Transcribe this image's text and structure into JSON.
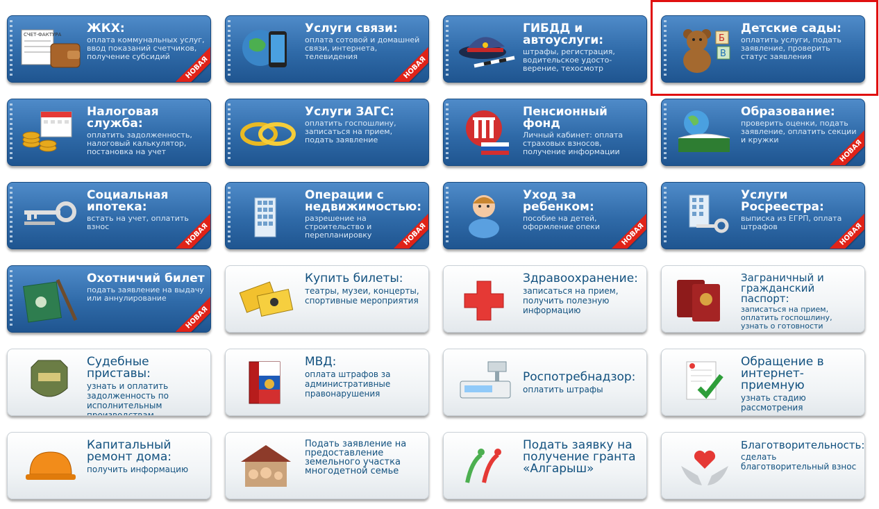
{
  "badge_new": "НОВАЯ",
  "accent": {
    "tile_blue": "#2f6aa8",
    "highlight": "#e01010",
    "ribbon": "#e02318"
  },
  "tiles": [
    {
      "id": "zhkh",
      "title": "ЖКХ:",
      "desc": "оплата коммунальных услуг, ввод показаний счетчиков, получение субсидий",
      "style": "blue",
      "new": true,
      "icon": "invoice-wallet-icon"
    },
    {
      "id": "svyaz",
      "title": "Услуги связи:",
      "desc": "оплата сотовой и домашней связи, интернета, телевидения",
      "style": "blue",
      "new": true,
      "icon": "globe-phone-icon"
    },
    {
      "id": "gibdd",
      "title": "ГИБДД и автоуслуги:",
      "desc": "штрафы, регистрация, водительское удосто-верение, техосмотр",
      "style": "blue",
      "new": false,
      "icon": "police-cap-icon"
    },
    {
      "id": "sady",
      "title": "Детские сады:",
      "desc": "оплатить услуги, подать заявление, проверить статус заявления",
      "style": "blue",
      "new": false,
      "icon": "teddy-bear-icon"
    },
    {
      "id": "nalog",
      "title": "Налоговая служба:",
      "desc": "оплатить задолженность, налоговый калькулятор, постановка на учет",
      "style": "blue",
      "new": false,
      "icon": "coins-calendar-icon"
    },
    {
      "id": "zags",
      "title": "Услуги ЗАГС:",
      "desc": "оплатить госпошлину, записаться на прием, подать заявление",
      "style": "blue",
      "new": false,
      "icon": "rings-icon"
    },
    {
      "id": "pfr",
      "title": "Пенсионный фонд",
      "desc": "Личный кабинет: оплата страховых взносов, получение информации",
      "style": "blue",
      "new": false,
      "icon": "pfr-logo-icon"
    },
    {
      "id": "obraz",
      "title": "Образование:",
      "desc": "проверить оценки, подать заявление, оплатить секции и кружки",
      "style": "blue",
      "new": true,
      "icon": "globe-book-icon"
    },
    {
      "id": "ipoteka",
      "title": "Социальная ипотека:",
      "desc": "встать на учет, оплатить взнос",
      "style": "blue",
      "new": true,
      "icon": "keys-icon"
    },
    {
      "id": "nedv",
      "title": "Операции с недвижимостью:",
      "desc": "разрешение на строительство и перепланировку",
      "style": "blue",
      "new": true,
      "icon": "building-icon"
    },
    {
      "id": "rebenok",
      "title": "Уход за ребенком:",
      "desc": "пособие на детей, оформление опеки",
      "style": "blue",
      "new": true,
      "icon": "child-icon"
    },
    {
      "id": "rosreestr",
      "title": "Услуги Росреестра:",
      "desc": "выписка из ЕГРП, оплата штрафов",
      "style": "blue",
      "new": true,
      "icon": "building-keys-icon"
    },
    {
      "id": "ohota",
      "title": "Охотничий билет",
      "desc": "подать заявление на выдачу или аннулирование",
      "style": "blue",
      "new": true,
      "icon": "hunting-ticket-icon"
    },
    {
      "id": "bilety",
      "title": "Купить билеты:",
      "desc": "театры, музеи, концерты, спортивные мероприятия",
      "style": "white",
      "new": false,
      "icon": "tickets-icon"
    },
    {
      "id": "zdrav",
      "title": "Здравоохранение:",
      "desc": "записаться на прием, получить полезную информацию",
      "style": "white",
      "new": false,
      "icon": "red-cross-icon"
    },
    {
      "id": "pasport",
      "title": "Заграничный и гражданский паспорт:",
      "desc": "записаться на прием, оплатить госпошлину, узнать о готовности",
      "style": "white",
      "new": false,
      "icon": "passport-icon"
    },
    {
      "id": "pristavy",
      "title": "Судебные приставы:",
      "desc": "узнать и оплатить задолженность по исполнительным производствам",
      "style": "white",
      "new": false,
      "icon": "bailiff-emblem-icon"
    },
    {
      "id": "mvd",
      "title": "МВД:",
      "desc": "оплата штрафов за административные правонарушения",
      "style": "white",
      "new": false,
      "icon": "codex-book-icon"
    },
    {
      "id": "rospotreb",
      "title": "Роспотребнадзор:",
      "desc": "оплатить штрафы",
      "style": "white",
      "new": false,
      "icon": "scales-icon"
    },
    {
      "id": "obrashenie",
      "title": "Обращение в интернет-приемную",
      "desc": "узнать стадию рассмотрения",
      "style": "white",
      "new": false,
      "icon": "document-check-icon"
    },
    {
      "id": "kapremont",
      "title": "Капитальный ремонт дома:",
      "desc": "получить информацию",
      "style": "white",
      "new": false,
      "icon": "hard-hat-icon"
    },
    {
      "id": "mnogodet",
      "title": "Подать заявление на предоставление земельного участка многодетной семье",
      "desc": "",
      "style": "white",
      "new": false,
      "icon": "family-house-icon"
    },
    {
      "id": "grant",
      "title": "Подать заявку на получение гранта «Алгарыш»",
      "desc": "",
      "style": "white",
      "new": false,
      "icon": "algarysh-logo-icon"
    },
    {
      "id": "blago",
      "title": "Благотворительность:",
      "desc": "сделать благотворительный взнос",
      "style": "white",
      "new": false,
      "icon": "heart-hands-icon"
    }
  ]
}
